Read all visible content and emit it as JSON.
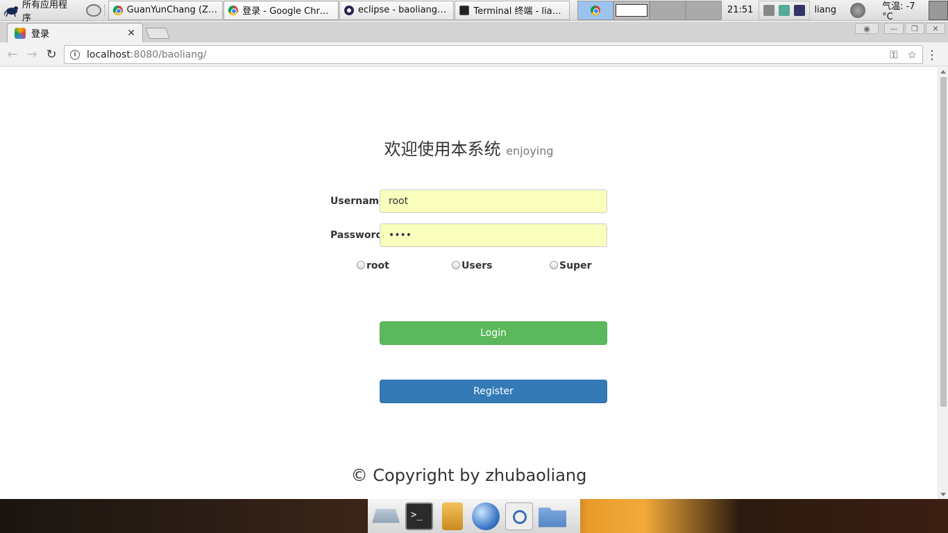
{
  "taskbar": {
    "apps_menu": "所有应用程序",
    "tasks": [
      {
        "label": "GuanYunChang (ZhuB…",
        "icon": "chrome-icon"
      },
      {
        "label": "登录 - Google Chrome",
        "icon": "chrome-icon"
      },
      {
        "label": "eclipse - baoliang/src…",
        "icon": "eclipse-icon"
      },
      {
        "label": "Terminal 终端 - liang…",
        "icon": "terminal-icon"
      }
    ],
    "time": "21:51",
    "user": "liang",
    "weather": "气温: -7 °C"
  },
  "browser": {
    "tab_title": "登录",
    "url_host": "localhost",
    "url_path": ":8080/baoliang/"
  },
  "page": {
    "heading": "欢迎使用本系统",
    "heading_small": "enjoying",
    "username_label": "Username",
    "username_value": "root",
    "password_label": "Password",
    "password_value": "••••",
    "roles": [
      "root",
      "Users",
      "Super"
    ],
    "login_label": "Login",
    "register_label": "Register",
    "footer": "© Copyright by zhubaoliang"
  },
  "colors": {
    "login": "#5cb85c",
    "register": "#337ab7",
    "autofill": "#faffbd"
  }
}
